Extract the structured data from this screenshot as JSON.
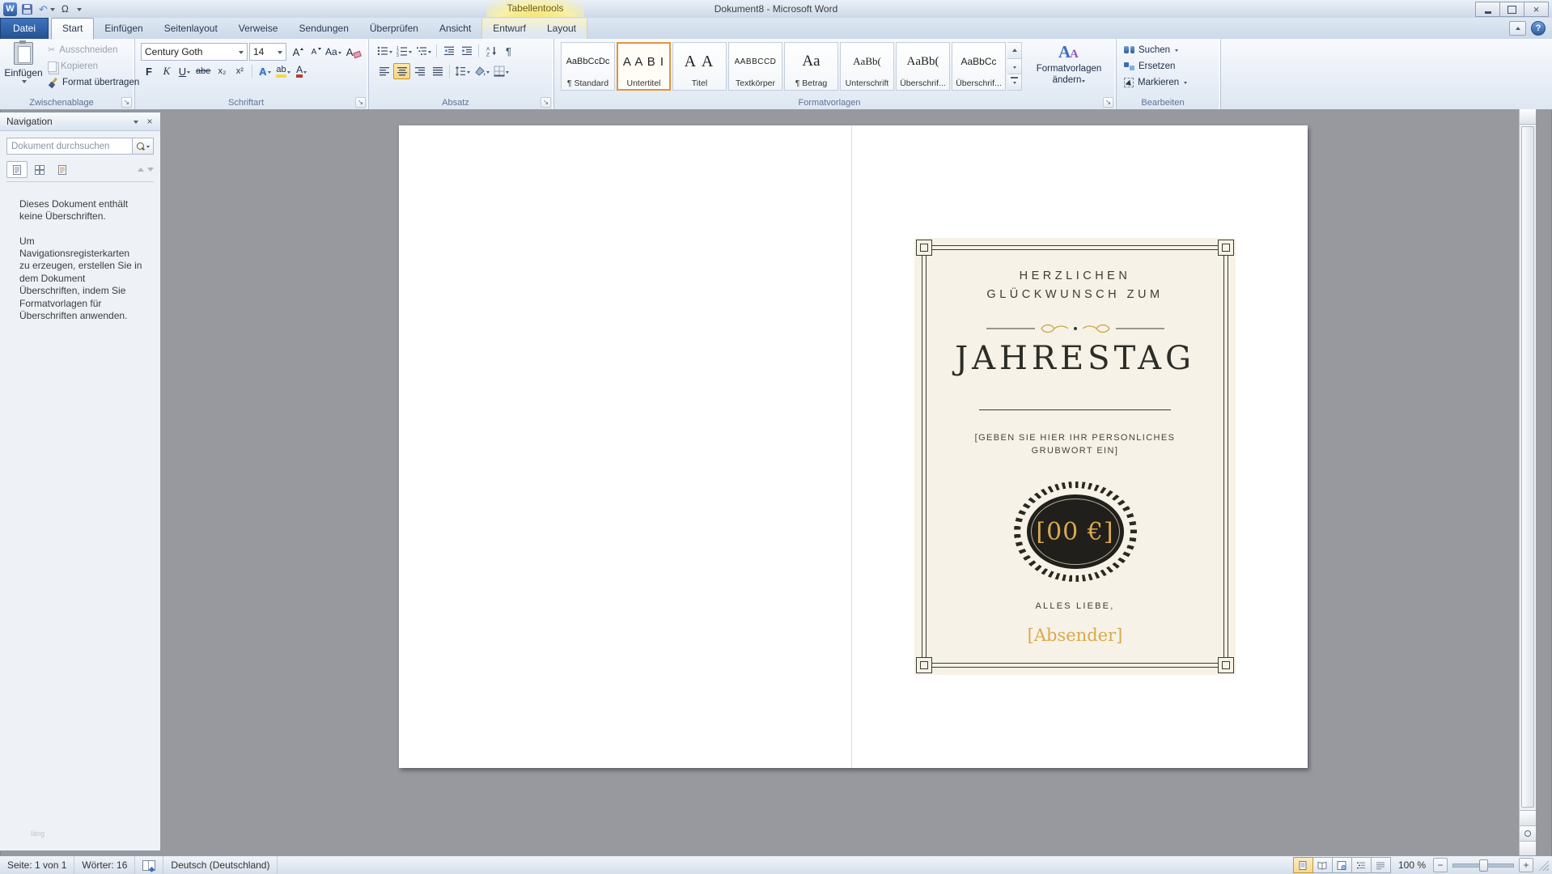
{
  "titlebar": {
    "title": "Dokument8 - Microsoft Word",
    "contextual_group": "Tabellentools",
    "omega": "Ω"
  },
  "icons": {
    "undo": "↶",
    "scissors": "✂",
    "help": "?",
    "close": "×",
    "dialog_launcher": "↘"
  },
  "ribbon_tabs": {
    "items": [
      {
        "label": "Datei"
      },
      {
        "label": "Start"
      },
      {
        "label": "Einfügen"
      },
      {
        "label": "Seitenlayout"
      },
      {
        "label": "Verweise"
      },
      {
        "label": "Sendungen"
      },
      {
        "label": "Überprüfen"
      },
      {
        "label": "Ansicht"
      },
      {
        "label": "Entwurf"
      },
      {
        "label": "Layout"
      }
    ]
  },
  "ribbon": {
    "clipboard": {
      "group_label": "Zwischenablage",
      "paste": "Einfügen",
      "cut": "Ausschneiden",
      "copy": "Kopieren",
      "format_painter": "Format übertragen"
    },
    "font": {
      "group_label": "Schriftart",
      "family": "Century Goth",
      "size": "14",
      "grow": "A",
      "shrink": "A",
      "case_button": "Aa",
      "clear": "A",
      "bold": "F",
      "italic": "K",
      "underline": "U",
      "strikethrough": "abe",
      "subscript": "x₂",
      "superscript": "x²",
      "effects": "A",
      "highlight": "ab",
      "font_color": "A"
    },
    "paragraph": {
      "group_label": "Absatz",
      "sort_a": "A",
      "sort_z": "Z",
      "pilcrow": "¶"
    },
    "styles": {
      "group_label": "Formatvorlagen",
      "items": [
        {
          "preview": "AaBbCcDc",
          "label": "¶ Standard"
        },
        {
          "preview": "A A B I",
          "label": "Untertitel"
        },
        {
          "preview": "A A",
          "label": "Titel"
        },
        {
          "preview": "AABBCCD",
          "label": "Textkörper"
        },
        {
          "preview": "Aa",
          "label": "¶ Betrag"
        },
        {
          "preview": "AaBb(",
          "label": "Unterschrift"
        },
        {
          "preview": "AaBb(",
          "label": "Überschrif..."
        },
        {
          "preview": "AaBbCc",
          "label": "Überschrif..."
        }
      ],
      "change_styles_line1": "Formatvorlagen",
      "change_styles_line2": "ändern"
    },
    "editing": {
      "group_label": "Bearbeiten",
      "find": "Suchen",
      "replace": "Ersetzen",
      "select": "Markieren"
    }
  },
  "navigation": {
    "title": "Navigation",
    "search_placeholder": "Dokument durchsuchen",
    "empty_heading_text": "Dieses Dokument enthält keine Überschriften.",
    "hint_text": "Um Navigationsregisterkarten zu erzeugen, erstellen Sie in dem Dokument Überschriften, indem Sie Formatvorlagen für Überschriften anwenden.",
    "artifact": "läng"
  },
  "card": {
    "heading_line1": "HERZLICHEN",
    "heading_line2": "GLÜCKWUNSCH ZUM",
    "title": "JAHRESTAG",
    "greeting_line1": "[GEBEN SIE HIER IHR PERSONLICHES",
    "greeting_line2": "GRUBWORT EIN]",
    "amount": "[00 €]",
    "closing": "ALLES LIEBE,",
    "sender": "[Absender]"
  },
  "statusbar": {
    "page": "Seite: 1 von 1",
    "words": "Wörter: 16",
    "language": "Deutsch (Deutschland)",
    "zoom": "100 %"
  },
  "colors": {
    "accent_gold": "#c9a23f",
    "card_background": "#f6f2e7",
    "seal_black": "#201f1b",
    "selection_orange": "#e0953b",
    "contextual_yellow": "#f3e37a"
  }
}
